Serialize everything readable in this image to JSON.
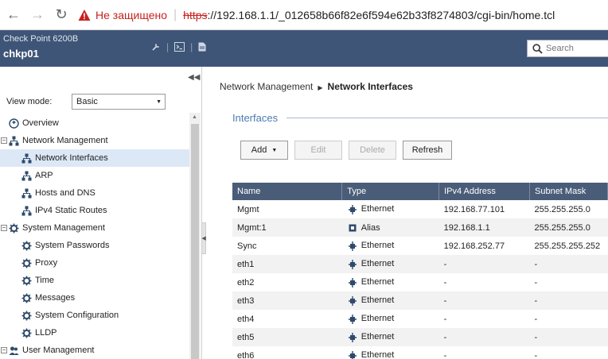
{
  "browser": {
    "insecure_label": "Не защищено",
    "url_scheme": "https",
    "url_rest": "://192.168.1.1/_012658b66f82e6f594e62b33f8274803/cgi-bin/home.tcl"
  },
  "header": {
    "model": "Check Point 6200B",
    "hostname": "chkp01",
    "search_placeholder": "Search"
  },
  "sidebar": {
    "view_mode_label": "View mode:",
    "view_mode_value": "Basic",
    "items": [
      {
        "label": "Overview",
        "icon": "overview-icon",
        "indent": 10,
        "toggle": false
      },
      {
        "label": "Network Management",
        "icon": "network-icon",
        "indent": 10,
        "toggle": true
      },
      {
        "label": "Network Interfaces",
        "icon": "network-icon",
        "indent": 26,
        "toggle": false,
        "selected": true
      },
      {
        "label": "ARP",
        "icon": "network-icon",
        "indent": 26,
        "toggle": false
      },
      {
        "label": "Hosts and DNS",
        "icon": "network-icon",
        "indent": 26,
        "toggle": false
      },
      {
        "label": "IPv4 Static Routes",
        "icon": "network-icon",
        "indent": 26,
        "toggle": false
      },
      {
        "label": "System Management",
        "icon": "gear-icon",
        "indent": 10,
        "toggle": true
      },
      {
        "label": "System Passwords",
        "icon": "gear-icon",
        "indent": 26,
        "toggle": false
      },
      {
        "label": "Proxy",
        "icon": "gear-icon",
        "indent": 26,
        "toggle": false
      },
      {
        "label": "Time",
        "icon": "gear-icon",
        "indent": 26,
        "toggle": false
      },
      {
        "label": "Messages",
        "icon": "gear-icon",
        "indent": 26,
        "toggle": false
      },
      {
        "label": "System Configuration",
        "icon": "gear-icon",
        "indent": 26,
        "toggle": false
      },
      {
        "label": "LLDP",
        "icon": "gear-icon",
        "indent": 26,
        "toggle": false
      },
      {
        "label": "User Management",
        "icon": "users-icon",
        "indent": 10,
        "toggle": true
      }
    ]
  },
  "main": {
    "breadcrumb_parent": "Network Management",
    "breadcrumb_current": "Network Interfaces",
    "section_title": "Interfaces",
    "buttons": {
      "add": "Add",
      "edit": "Edit",
      "delete": "Delete",
      "refresh": "Refresh"
    },
    "columns": [
      "Name",
      "Type",
      "IPv4 Address",
      "Subnet Mask"
    ],
    "rows": [
      {
        "name": "Mgmt",
        "type": "Ethernet",
        "ipv4": "192.168.77.101",
        "mask": "255.255.255.0"
      },
      {
        "name": "Mgmt:1",
        "type": "Alias",
        "ipv4": "192.168.1.1",
        "mask": "255.255.255.0"
      },
      {
        "name": "Sync",
        "type": "Ethernet",
        "ipv4": "192.168.252.77",
        "mask": "255.255.255.252"
      },
      {
        "name": "eth1",
        "type": "Ethernet",
        "ipv4": "-",
        "mask": "-"
      },
      {
        "name": "eth2",
        "type": "Ethernet",
        "ipv4": "-",
        "mask": "-"
      },
      {
        "name": "eth3",
        "type": "Ethernet",
        "ipv4": "-",
        "mask": "-"
      },
      {
        "name": "eth4",
        "type": "Ethernet",
        "ipv4": "-",
        "mask": "-"
      },
      {
        "name": "eth5",
        "type": "Ethernet",
        "ipv4": "-",
        "mask": "-"
      },
      {
        "name": "eth6",
        "type": "Ethernet",
        "ipv4": "-",
        "mask": "-"
      }
    ]
  },
  "colors": {
    "header_bg": "#3f5577",
    "grid_header_bg": "#4a5d78",
    "accent": "#4d7bb0",
    "insecure": "#c5221f"
  }
}
